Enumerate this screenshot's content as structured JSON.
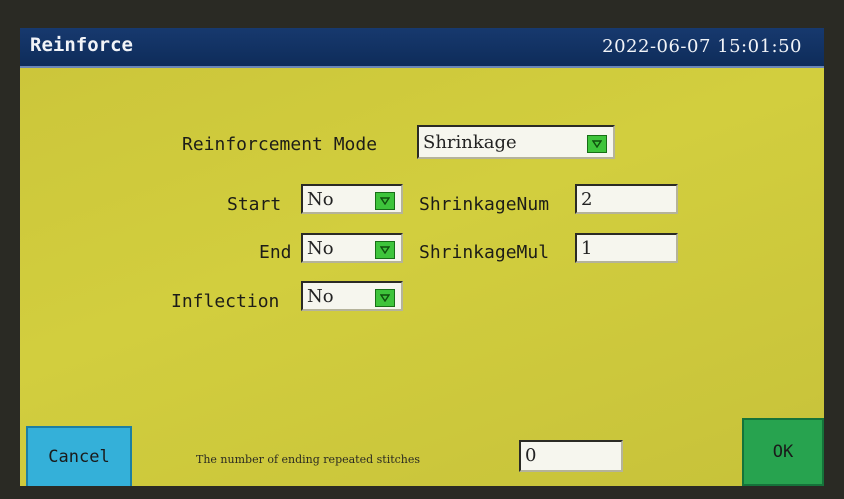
{
  "window": {
    "title": "Reinforce",
    "datetime": "2022-06-07 15:01:50"
  },
  "reinforcement_mode": {
    "label": "Reinforcement Mode",
    "value": "Shrinkage"
  },
  "start": {
    "label": "Start",
    "value": "No"
  },
  "end": {
    "label": "End",
    "value": "No"
  },
  "inflection": {
    "label": "Inflection",
    "value": "No"
  },
  "shrinkage_num": {
    "label": "ShrinkageNum",
    "value": "2"
  },
  "shrinkage_mul": {
    "label": "ShrinkageMul",
    "value": "1"
  },
  "ending_repeat": {
    "label": "The number of ending repeated stitches",
    "value": "0"
  },
  "buttons": {
    "cancel": "Cancel",
    "ok": "OK"
  },
  "colors": {
    "screen_background": "#cbc53a",
    "titlebar": "#17396e",
    "cancel_button": "#34b0d9",
    "ok_button": "#27a34f",
    "dropdown_arrow_button": "#3ec43b"
  },
  "icons": {
    "dropdown": "triangle-down-icon"
  }
}
